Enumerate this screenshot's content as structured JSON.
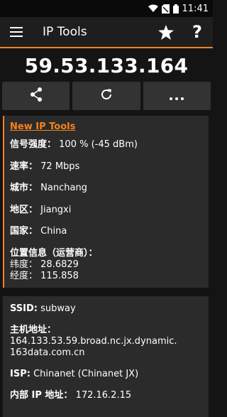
{
  "status": {
    "time": "11:41"
  },
  "appbar": {
    "title": "IP Tools",
    "accent": "#f58220"
  },
  "ip_address": "59.53.133.164",
  "actions": [
    "share-icon",
    "refresh-icon",
    "more-icon"
  ],
  "card": {
    "link": "New IP Tools",
    "signal_label": "信号强度：",
    "signal_value": "100 % (-45 dBm)",
    "speed_label": "速率：",
    "speed_value": "72 Mbps",
    "city_label": "城市：",
    "city_value": "Nanchang",
    "region_label": "地区：",
    "region_value": "Jiangxi",
    "country_label": "国家：",
    "country_value": "China",
    "location_label": "位置信息（运营商）：",
    "lat_label": "纬度：",
    "lat_value": "28.6829",
    "lon_label": "经度：",
    "lon_value": "115.858"
  },
  "card2": {
    "ssid_label": "SSID:",
    "ssid_value": "subway",
    "host_label": "主机地址：",
    "host_value": "164.133.53.59.broad.nc.jx.dynamic.\n163data.com.cn",
    "isp_label": "ISP:",
    "isp_value": "Chinanet (Chinanet JX)",
    "internal_label": "内部 IP 地址：",
    "internal_value": "172.16.2.15"
  }
}
